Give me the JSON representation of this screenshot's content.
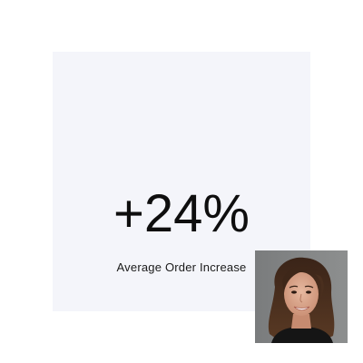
{
  "stat": {
    "value": "+24%",
    "label": "Average Order Increase"
  },
  "colors": {
    "card_background": "#f4f5fa",
    "text": "#0e0e0e",
    "page_background": "#ffffff"
  }
}
